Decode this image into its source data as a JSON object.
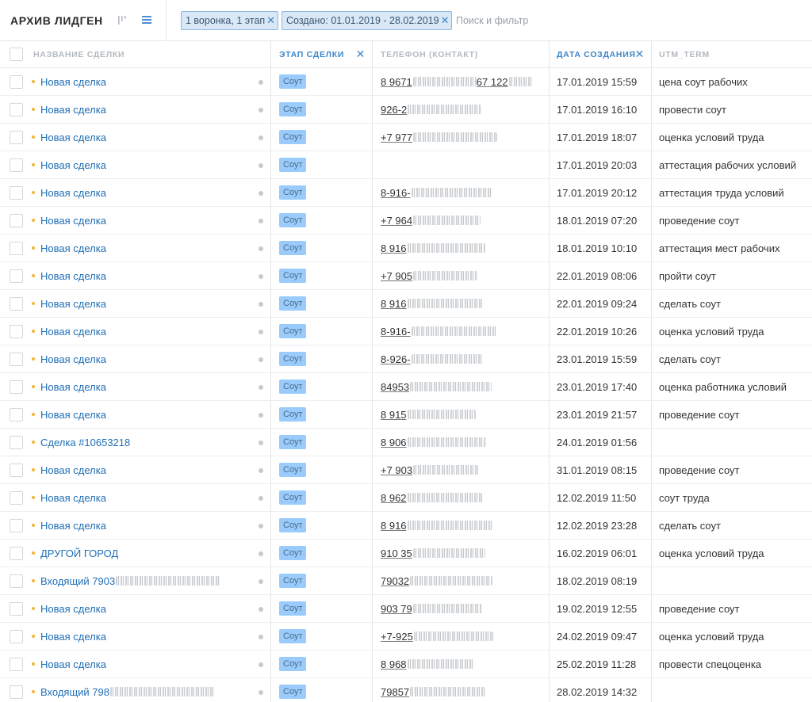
{
  "header": {
    "title": "АРХИВ ЛИДГЕН",
    "filters": [
      {
        "label": "1 воронка, 1 этап"
      },
      {
        "label": "Создано: 01.01.2019 - 28.02.2019"
      }
    ],
    "search_placeholder": "Поиск и фильтр",
    "pipeline_icon": "pipeline-view-icon",
    "list_icon": "list-view-icon"
  },
  "columns": {
    "name": "НАЗВАНИЕ СДЕЛКИ",
    "stage": "ЭТАП СДЕЛКИ",
    "phone": "ТЕЛЕФОН (КОНТАКТ)",
    "date": "ДАТА СОЗДАНИЯ",
    "utm": "UTM_TERM"
  },
  "colors": {
    "accent": "#3b86c8",
    "link": "#1f6eb5",
    "stage_badge": "#99ccfd",
    "dot": "#f0b43c"
  },
  "rows": [
    {
      "name": "Новая сделка",
      "stage": "Соут",
      "phone": "8 9671",
      "phone_tail": "67 122",
      "date": "17.01.2019 15:59",
      "utm": "цена соут рабочих"
    },
    {
      "name": "Новая сделка",
      "stage": "Соут",
      "phone": "926-2",
      "phone_tail": "",
      "date": "17.01.2019 16:10",
      "utm": "провести соут"
    },
    {
      "name": "Новая сделка",
      "stage": "Соут",
      "phone": "+7 977",
      "phone_tail": "",
      "date": "17.01.2019 18:07",
      "utm": "оценка условий труда"
    },
    {
      "name": "Новая сделка",
      "stage": "Соут",
      "phone": "",
      "phone_tail": "",
      "date": "17.01.2019 20:03",
      "utm": "аттестация рабочих условий"
    },
    {
      "name": "Новая сделка",
      "stage": "Соут",
      "phone": "8-916-",
      "phone_tail": "",
      "date": "17.01.2019 20:12",
      "utm": "аттестация труда условий"
    },
    {
      "name": "Новая сделка",
      "stage": "Соут",
      "phone": "+7 964",
      "phone_tail": "",
      "date": "18.01.2019 07:20",
      "utm": "проведение соут"
    },
    {
      "name": "Новая сделка",
      "stage": "Соут",
      "phone": "8 916",
      "phone_tail": "",
      "date": "18.01.2019 10:10",
      "utm": "аттестация мест рабочих"
    },
    {
      "name": "Новая сделка",
      "stage": "Соут",
      "phone": "+7 905",
      "phone_tail": "",
      "date": "22.01.2019 08:06",
      "utm": "пройти соут"
    },
    {
      "name": "Новая сделка",
      "stage": "Соут",
      "phone": "8 916",
      "phone_tail": "",
      "date": "22.01.2019 09:24",
      "utm": "сделать соут"
    },
    {
      "name": "Новая сделка",
      "stage": "Соут",
      "phone": "8-916-",
      "phone_tail": "",
      "date": "22.01.2019 10:26",
      "utm": "оценка условий труда"
    },
    {
      "name": "Новая сделка",
      "stage": "Соут",
      "phone": "8-926-",
      "phone_tail": "",
      "date": "23.01.2019 15:59",
      "utm": "сделать соут"
    },
    {
      "name": "Новая сделка",
      "stage": "Соут",
      "phone": "84953",
      "phone_tail": "",
      "date": "23.01.2019 17:40",
      "utm": "оценка работника условий"
    },
    {
      "name": "Новая сделка",
      "stage": "Соут",
      "phone": "8 915",
      "phone_tail": "",
      "date": "23.01.2019 21:57",
      "utm": "проведение соут"
    },
    {
      "name": "Сделка #10653218",
      "stage": "Соут",
      "phone": "8 906",
      "phone_tail": "",
      "date": "24.01.2019 01:56",
      "utm": ""
    },
    {
      "name": "Новая сделка",
      "stage": "Соут",
      "phone": "+7 903",
      "phone_tail": "",
      "date": "31.01.2019 08:15",
      "utm": "проведение соут"
    },
    {
      "name": "Новая сделка",
      "stage": "Соут",
      "phone": "8 962",
      "phone_tail": "",
      "date": "12.02.2019 11:50",
      "utm": "соут труда"
    },
    {
      "name": "Новая сделка",
      "stage": "Соут",
      "phone": "8 916",
      "phone_tail": "",
      "date": "12.02.2019 23:28",
      "utm": "сделать соут"
    },
    {
      "name": "ДРУГОЙ ГОРОД",
      "stage": "Соут",
      "phone": "910 35",
      "phone_tail": "",
      "date": "16.02.2019 06:01",
      "utm": "оценка условий труда"
    },
    {
      "name": "Входящий 7903",
      "stage": "Соут",
      "phone": "79032",
      "phone_tail": "",
      "date": "18.02.2019 08:19",
      "utm": ""
    },
    {
      "name": "Новая сделка",
      "stage": "Соут",
      "phone": "903 79",
      "phone_tail": "",
      "date": "19.02.2019 12:55",
      "utm": "проведение соут"
    },
    {
      "name": "Новая сделка",
      "stage": "Соут",
      "phone": "+7-925",
      "phone_tail": "",
      "date": "24.02.2019 09:47",
      "utm": "оценка условий труда"
    },
    {
      "name": "Новая сделка",
      "stage": "Соут",
      "phone": "8 968",
      "phone_tail": "",
      "date": "25.02.2019 11:28",
      "utm": "провести спецоценка"
    },
    {
      "name": "Входящий 798",
      "stage": "Соут",
      "phone": "79857",
      "phone_tail": "",
      "date": "28.02.2019 14:32",
      "utm": ""
    }
  ]
}
